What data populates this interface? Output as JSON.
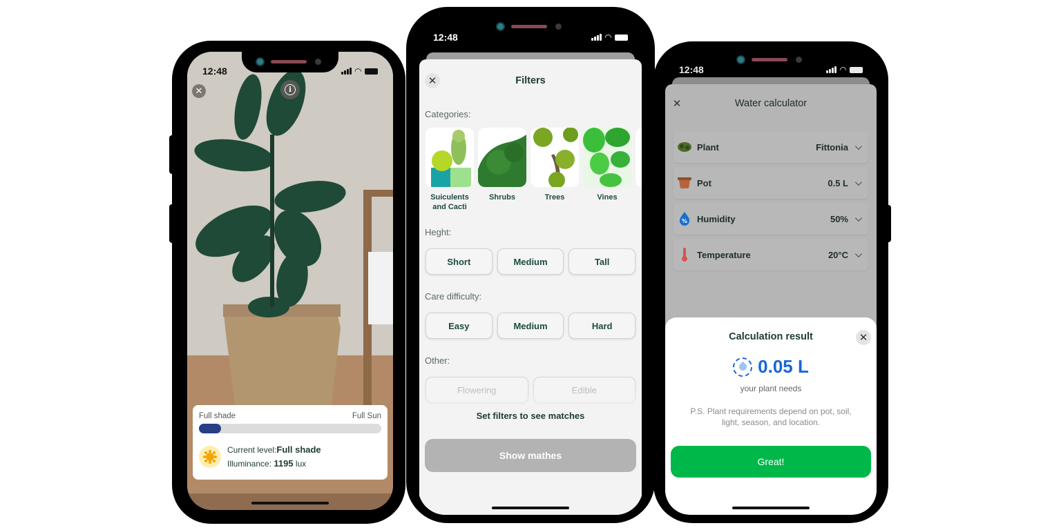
{
  "status_bar": {
    "time": "12:48"
  },
  "light_meter_screen": {
    "close_icon": "close-icon",
    "info_icon": "info-icon",
    "scale_min_label": "Full shade",
    "scale_max_label": "Full Sun",
    "light_level_fraction": 0.12,
    "current_level_label": "Current level:",
    "current_level_value": "Full shade",
    "illuminance_label": "Illuminance:",
    "illuminance_value": "1195",
    "illuminance_unit": "lux",
    "colors": {
      "fill": "#263f87",
      "sun": "#f6a400"
    }
  },
  "filters_screen": {
    "title": "Filters",
    "categories_label": "Categories:",
    "categories": [
      {
        "label": "Suiculents and Cacti",
        "icon": "cactus-image"
      },
      {
        "label": "Shrubs",
        "icon": "shrub-image"
      },
      {
        "label": "Trees",
        "icon": "tree-image"
      },
      {
        "label": "Vines",
        "icon": "vine-image"
      }
    ],
    "height_label": "Heght:",
    "height_options": [
      "Short",
      "Medium",
      "Tall"
    ],
    "care_label": "Care difficulty:",
    "care_options": [
      "Easy",
      "Medium",
      "Hard"
    ],
    "other_label": "Other:",
    "other_options": [
      "Flowering",
      "Edible"
    ],
    "hint": "Set filters to see matches",
    "show_button": "Show mathes"
  },
  "water_calculator_screen": {
    "title": "Water calculator",
    "rows": [
      {
        "label": "Plant",
        "value": "Fittonia",
        "icon": "plant-icon"
      },
      {
        "label": "Pot",
        "value": "0.5 L",
        "icon": "pot-icon"
      },
      {
        "label": "Humidity",
        "value": "50%",
        "icon": "humidity-icon"
      },
      {
        "label": "Temperature",
        "value": "20°C",
        "icon": "thermometer-icon"
      }
    ],
    "result": {
      "title": "Calculation result",
      "amount": "0.05 L",
      "subtitle": "your plant needs",
      "note": "P.S. Plant requirements depend on pot, soil, light, season, and location.",
      "button": "Great!"
    },
    "colors": {
      "accent": "#1667d9",
      "button": "#00b84a"
    }
  }
}
